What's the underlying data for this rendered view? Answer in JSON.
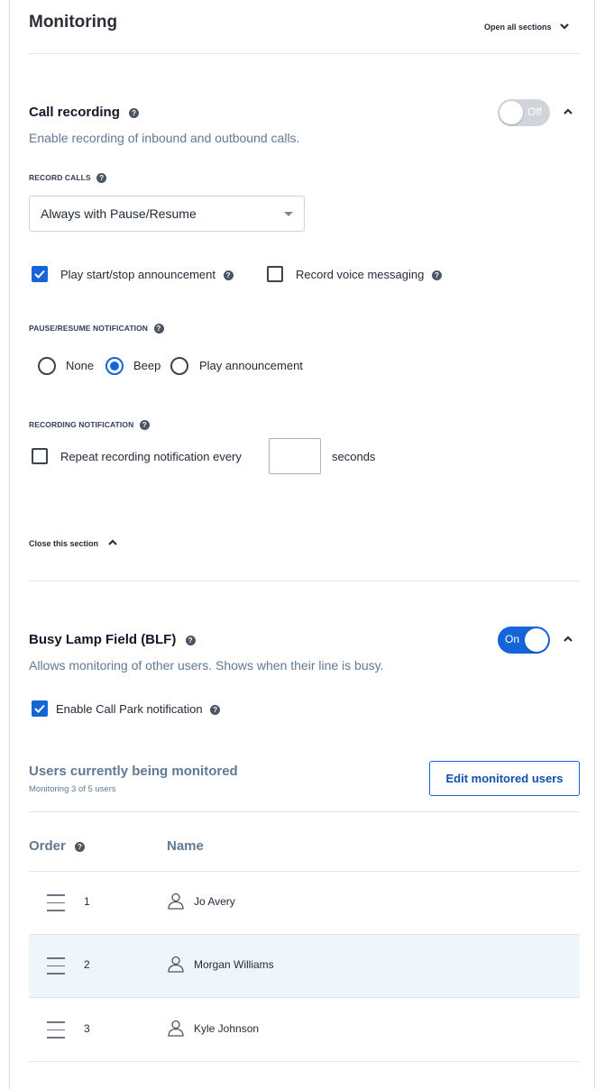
{
  "header": {
    "title": "Monitoring",
    "open_all": "Open all sections"
  },
  "call_recording": {
    "title": "Call recording",
    "toggle_label": "Off",
    "toggle_state": "off",
    "description": "Enable recording of inbound and outbound calls.",
    "record_calls_label": "RECORD CALLS",
    "record_calls_value": "Always with Pause/Resume",
    "play_announcement_label": "Play start/stop announcement",
    "play_announcement_checked": true,
    "record_voice_label": "Record voice messaging",
    "record_voice_checked": false,
    "pause_resume_label": "PAUSE/RESUME NOTIFICATION",
    "pause_options": [
      {
        "label": "None",
        "selected": false
      },
      {
        "label": "Beep",
        "selected": true
      },
      {
        "label": "Play announcement",
        "selected": false
      }
    ],
    "recording_notification_label": "RECORDING NOTIFICATION",
    "repeat_label": "Repeat recording notification every",
    "repeat_checked": false,
    "repeat_value": "",
    "seconds_label": "seconds",
    "close_section": "Close this section"
  },
  "blf": {
    "title": "Busy Lamp Field (BLF)",
    "toggle_label": "On",
    "toggle_state": "on",
    "description": "Allows monitoring of other users. Shows when their line is busy.",
    "call_park_label": "Enable Call Park notification",
    "call_park_checked": true,
    "users_title": "Users currently being monitored",
    "users_subtitle": "Monitoring 3 of 5 users",
    "edit_button": "Edit monitored users",
    "columns": {
      "order": "Order",
      "name": "Name"
    },
    "users": [
      {
        "order": "1",
        "name": "Jo Avery"
      },
      {
        "order": "2",
        "name": "Morgan Williams"
      },
      {
        "order": "3",
        "name": "Kyle Johnson"
      }
    ]
  },
  "colors": {
    "accent": "#1565d8",
    "muted_text": "#607a94",
    "row_highlight": "#eef5fb"
  },
  "icons": [
    "help-icon",
    "chevron-down-icon",
    "chevron-up-icon",
    "checkmark-icon",
    "drag-handle-icon",
    "user-icon",
    "dropdown-arrow-icon"
  ]
}
